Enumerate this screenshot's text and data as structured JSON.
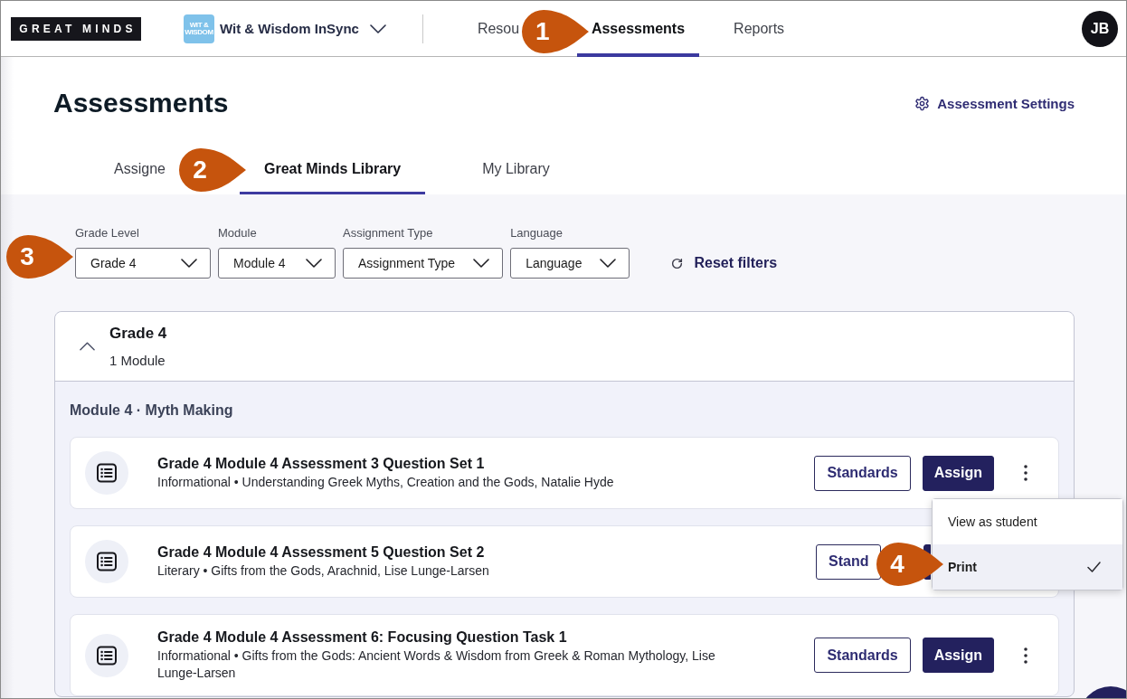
{
  "top_nav": {
    "logo": "GREAT MINDS",
    "product_logo": "WIT & WISDOM",
    "product": "Wit & Wisdom InSync",
    "links": [
      {
        "label": "Resou",
        "selected": false
      },
      {
        "label": "Assessments",
        "selected": true,
        "callout": "1"
      },
      {
        "label": "Reports",
        "selected": false
      }
    ],
    "avatar": "JB"
  },
  "header": {
    "title": "Assessments",
    "settings_link": "Assessment Settings"
  },
  "tabs": [
    {
      "label": "Assigne",
      "selected": false
    },
    {
      "label": "Great Minds Library",
      "selected": true,
      "callout": "2"
    },
    {
      "label": "My Library",
      "selected": false
    }
  ],
  "filters": {
    "fields": [
      {
        "label": "Grade Level",
        "value": "Grade 4",
        "callout": "3"
      },
      {
        "label": "Module",
        "value": "Module 4"
      },
      {
        "label": "Assignment Type",
        "value": "Assignment Type"
      },
      {
        "label": "Language",
        "value": "Language"
      }
    ],
    "reset": "Reset filters"
  },
  "group": {
    "title": "Grade 4",
    "subtitle": "1 Module",
    "expanded": true,
    "section_title": "Module 4 · Myth Making",
    "assessments": [
      {
        "title": "Grade 4 Module 4 Assessment 3 Question Set 1",
        "details": "Informational • Understanding Greek Myths, Creation and the Gods, Natalie Hyde",
        "buttons": [
          {
            "kind": "standards",
            "label": "Standards"
          },
          {
            "kind": "assign",
            "label": "Assign"
          },
          {
            "kind": "more"
          }
        ],
        "menu": {
          "items": [
            {
              "label": "View as student",
              "selected": false
            },
            {
              "label": "Print",
              "selected": true,
              "callout": "4"
            }
          ]
        }
      },
      {
        "title": "Grade 4 Module 4 Assessment 5 Question Set 2",
        "details": "Literary • Gifts from the Gods, Arachnid, Lise Lunge-Larsen",
        "buttons": [
          {
            "kind": "standards",
            "label": "Stand"
          },
          {
            "kind": "assign"
          }
        ]
      },
      {
        "title": "Grade 4 Module 4 Assessment 6: Focusing Question Task 1",
        "details": "Informational • Gifts from the Gods: Ancient Words & Wisdom from Greek & Roman Mythology, Lise Lunge-Larsen",
        "buttons": [
          {
            "kind": "standards",
            "label": "Standards"
          },
          {
            "kind": "assign",
            "label": "Assign"
          },
          {
            "kind": "more"
          }
        ]
      }
    ]
  }
}
